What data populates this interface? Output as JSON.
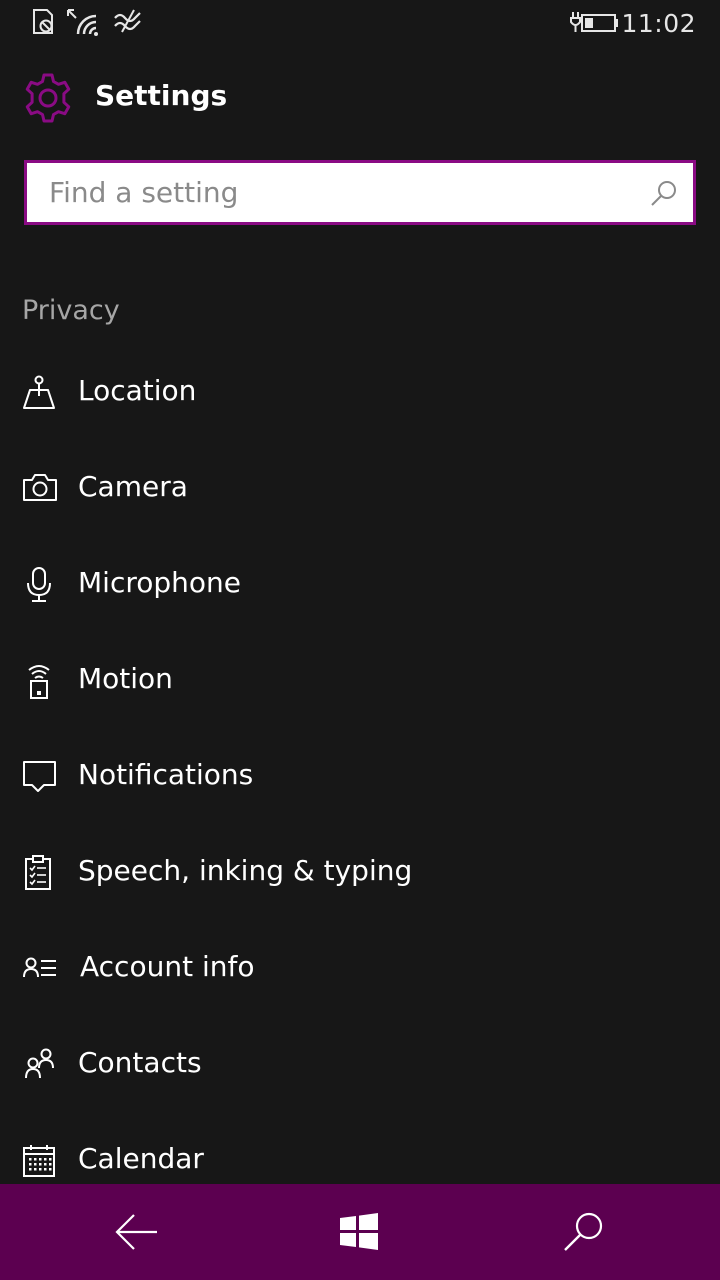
{
  "status_bar": {
    "time": "11:02",
    "icons": [
      "sim-blocked-icon",
      "wifi-icon",
      "data-icon",
      "battery-charging-icon"
    ]
  },
  "header": {
    "title": "Settings",
    "icon": "gear-icon"
  },
  "search": {
    "placeholder": "Find a setting",
    "value": ""
  },
  "section": {
    "heading": "Privacy"
  },
  "items": [
    {
      "label": "Location",
      "icon": "location-icon"
    },
    {
      "label": "Camera",
      "icon": "camera-icon"
    },
    {
      "label": "Microphone",
      "icon": "microphone-icon"
    },
    {
      "label": "Motion",
      "icon": "motion-icon"
    },
    {
      "label": "Notifications",
      "icon": "notifications-icon"
    },
    {
      "label": "Speech, inking & typing",
      "icon": "clipboard-icon"
    },
    {
      "label": "Account info",
      "icon": "account-info-icon"
    },
    {
      "label": "Contacts",
      "icon": "contacts-icon"
    },
    {
      "label": "Calendar",
      "icon": "calendar-icon"
    }
  ],
  "nav": {
    "back": "back-arrow-icon",
    "home": "windows-icon",
    "search": "search-icon"
  },
  "colors": {
    "background": "#171717",
    "accent": "#8a0b84",
    "nav_bar": "#5c0050",
    "section_heading": "#a6a6a6"
  }
}
